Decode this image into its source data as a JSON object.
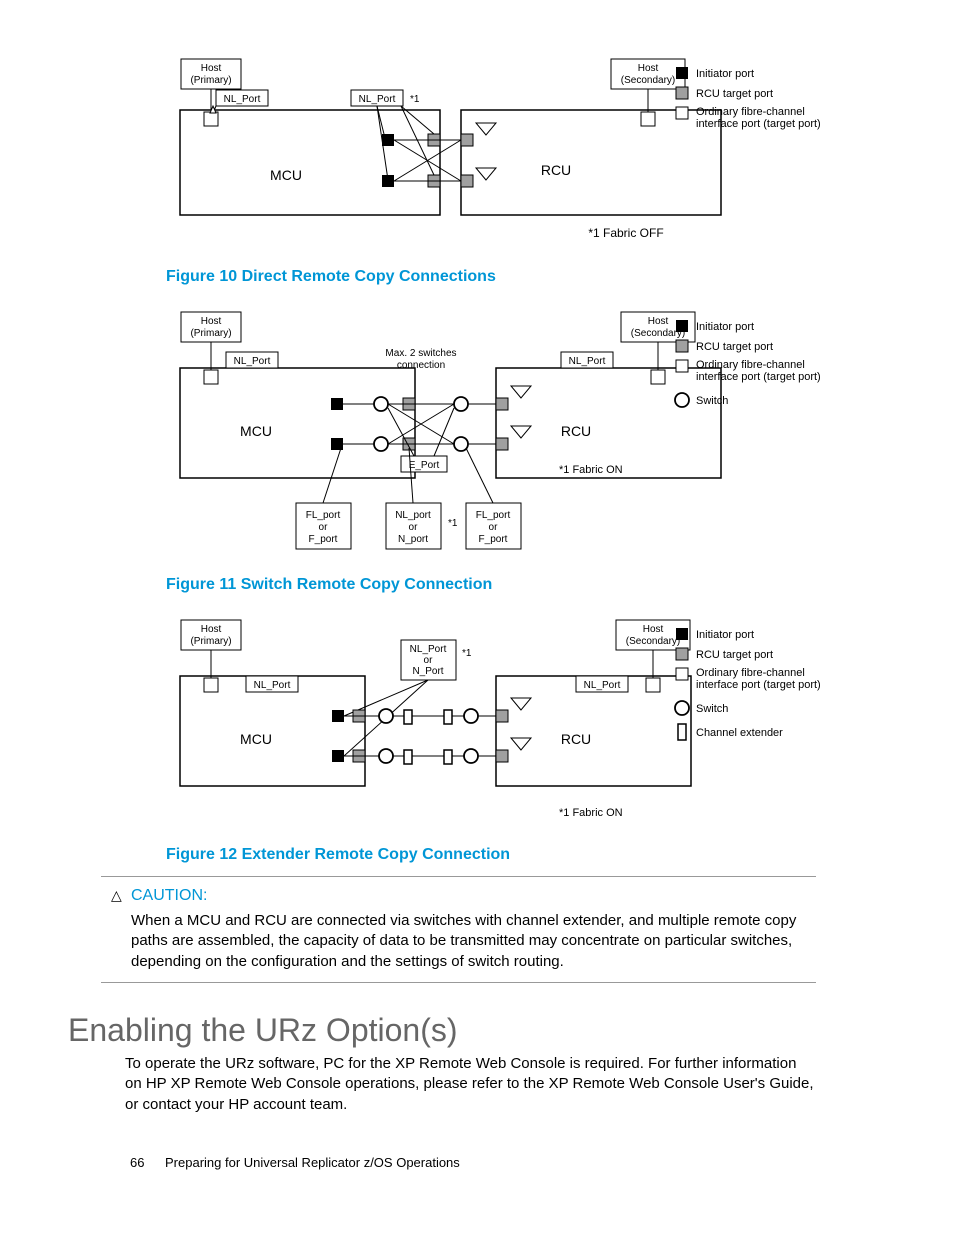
{
  "figures": {
    "f10": {
      "caption": "Figure 10 Direct Remote Copy Connections",
      "host_primary": "Host\n(Primary)",
      "host_secondary": "Host\n(Secondary)",
      "nl_port": "NL_Port",
      "mcu": "MCU",
      "rcu": "RCU",
      "star1": "*1",
      "fabric": "*1 Fabric OFF",
      "legend_initiator": "Initiator port",
      "legend_target": "RCU target port",
      "legend_ordinary": "Ordinary fibre-channel interface port (target port)"
    },
    "f11": {
      "caption": "Figure 11 Switch Remote Copy Connection",
      "host_primary": "Host\n(Primary)",
      "host_secondary": "Host\n(Secondary)",
      "nl_port": "NL_Port",
      "mcu": "MCU",
      "rcu": "RCU",
      "eport": "E_Port",
      "max_switches": "Max. 2 switches connection",
      "fl_or_f": "FL_port\nor\nF_port",
      "nl_or_n": "NL_port\nor\nN_port",
      "star1": "*1",
      "fabric": "*1 Fabric ON",
      "legend_initiator": "Initiator port",
      "legend_target": "RCU target port",
      "legend_ordinary": "Ordinary fibre-channel interface port (target port)",
      "legend_switch": "Switch"
    },
    "f12": {
      "caption": "Figure 12 Extender Remote Copy Connection",
      "host_primary": "Host\n(Primary)",
      "host_secondary": "Host\n(Secondary)",
      "nl_port": "NL_Port",
      "nl_or_n": "NL_Port\nor\nN_Port",
      "mcu": "MCU",
      "rcu": "RCU",
      "star1": "*1",
      "fabric": "*1 Fabric ON",
      "legend_initiator": "Initiator port",
      "legend_target": "RCU target port",
      "legend_ordinary": "Ordinary fibre-channel interface port (target port)",
      "legend_switch": "Switch",
      "legend_extender": "Channel extender"
    }
  },
  "caution": {
    "label": "CAUTION:",
    "text": "When a MCU and RCU are connected via switches with channel extender, and multiple remote copy paths are assembled, the capacity of data to be transmitted may concentrate on particular switches, depending on the configuration and the settings of switch routing."
  },
  "section_heading": "Enabling the URz Option(s)",
  "section_body": "To operate the URz software, PC for the XP Remote Web Console is required. For further information on HP XP Remote Web Console operations, please refer to the XP Remote Web Console User's Guide, or contact your HP account team.",
  "footer_page": "66",
  "footer_title": "Preparing for Universal Replicator z/OS Operations"
}
